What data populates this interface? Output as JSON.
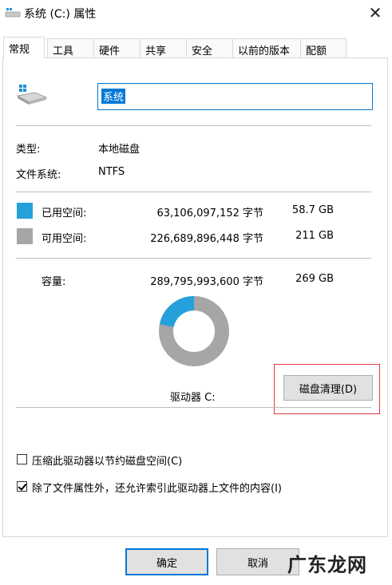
{
  "window": {
    "title": "系统 (C:) 属性"
  },
  "tabs": [
    {
      "label": "常规",
      "active": true
    },
    {
      "label": "工具"
    },
    {
      "label": "硬件"
    },
    {
      "label": "共享"
    },
    {
      "label": "安全"
    },
    {
      "label": "以前的版本"
    },
    {
      "label": "配额"
    }
  ],
  "drive": {
    "name": "系统"
  },
  "info": {
    "type_label": "类型:",
    "type_value": "本地磁盘",
    "fs_label": "文件系统:",
    "fs_value": "NTFS"
  },
  "space": {
    "used_label": "已用空间:",
    "used_bytes": "63,106,097,152 字节",
    "used_gb": "58.7 GB",
    "free_label": "可用空间:",
    "free_bytes": "226,689,896,448 字节",
    "free_gb": "211 GB",
    "cap_label": "容量:",
    "cap_bytes": "289,795,993,600 字节",
    "cap_gb": "269 GB",
    "used_color": "#26a0da",
    "free_color": "#a6a6a6",
    "used_fraction": 0.218
  },
  "drive_letter": "驱动器 C:",
  "cleanup_button": "磁盘清理(D)",
  "options": {
    "compress_label": "压缩此驱动器以节约磁盘空间(C)",
    "compress_checked": false,
    "index_label": "除了文件属性外，还允许索引此驱动器上文件的内容(I)",
    "index_checked": true
  },
  "buttons": {
    "ok": "确定",
    "cancel": "取消"
  },
  "watermark": "广东龙网"
}
